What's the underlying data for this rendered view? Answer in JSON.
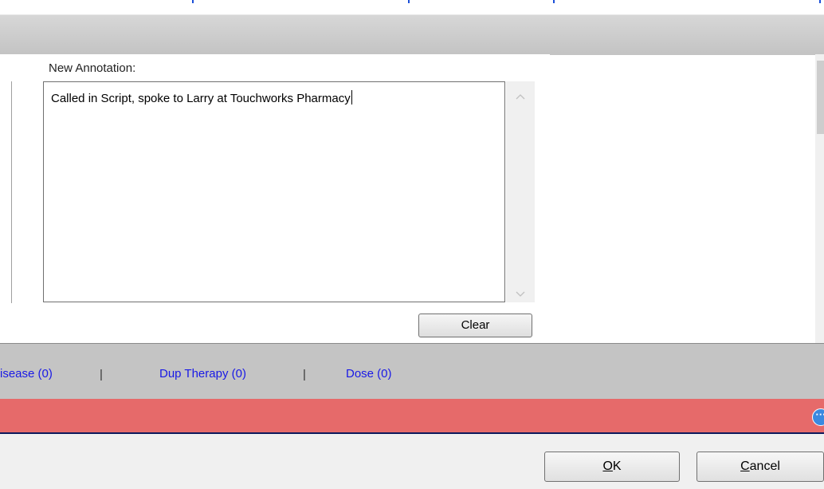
{
  "annotation": {
    "label": "New Annotation:",
    "text": "Called in Script, spoke to Larry at Touchworks Pharmacy",
    "clear_label": "Clear"
  },
  "scroll_icons": {
    "up": "chevron-up-icon",
    "down": "chevron-down-icon"
  },
  "alert_links": [
    {
      "label": "isease (0)"
    },
    {
      "label": "Dup Therapy (0)"
    },
    {
      "label": "Dose (0)"
    }
  ],
  "alert_separator": "|",
  "more_icon": "ellipsis-circle-icon",
  "dialog_buttons": {
    "ok_mnemonic": "O",
    "ok_rest": "K",
    "cancel_mnemonic": "C",
    "cancel_rest": "ancel"
  },
  "colors": {
    "link": "#1919e6",
    "alert_bar": "#e66a6a",
    "toolbar": "#c4c4c4"
  }
}
